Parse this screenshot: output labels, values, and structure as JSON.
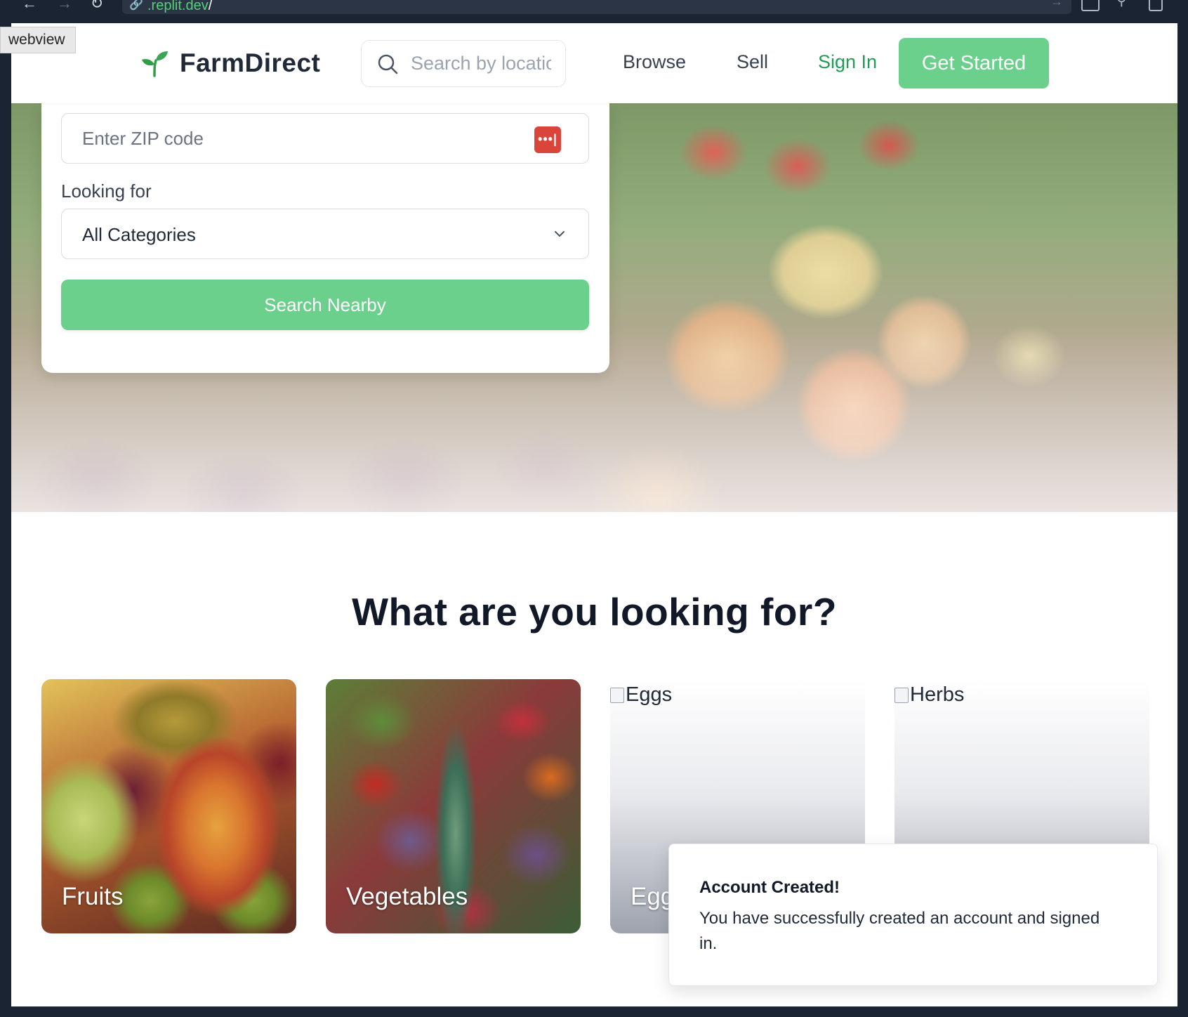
{
  "browser": {
    "url_prefix": ".replit.dev",
    "url_suffix": "/",
    "tooltip": "webview"
  },
  "header": {
    "brand": "FarmDirect",
    "search_placeholder": "Search by location...",
    "nav": [
      "Browse",
      "Sell"
    ],
    "sign_in": "Sign In",
    "get_started": "Get Started",
    "accent_color": "#6cd08d"
  },
  "search_card": {
    "zip_placeholder": "Enter ZIP code",
    "looking_for_label": "Looking for",
    "category_value": "All Categories",
    "search_button": "Search Nearby"
  },
  "categories": {
    "title": "What are you looking for?",
    "items": [
      {
        "label": "Fruits",
        "alt": ""
      },
      {
        "label": "Vegetables",
        "alt": ""
      },
      {
        "label": "Eggs",
        "alt": "Eggs"
      },
      {
        "label": "Herbs",
        "alt": "Herbs"
      }
    ]
  },
  "toast": {
    "title": "Account Created!",
    "message": "You have successfully created an account and signed in."
  }
}
